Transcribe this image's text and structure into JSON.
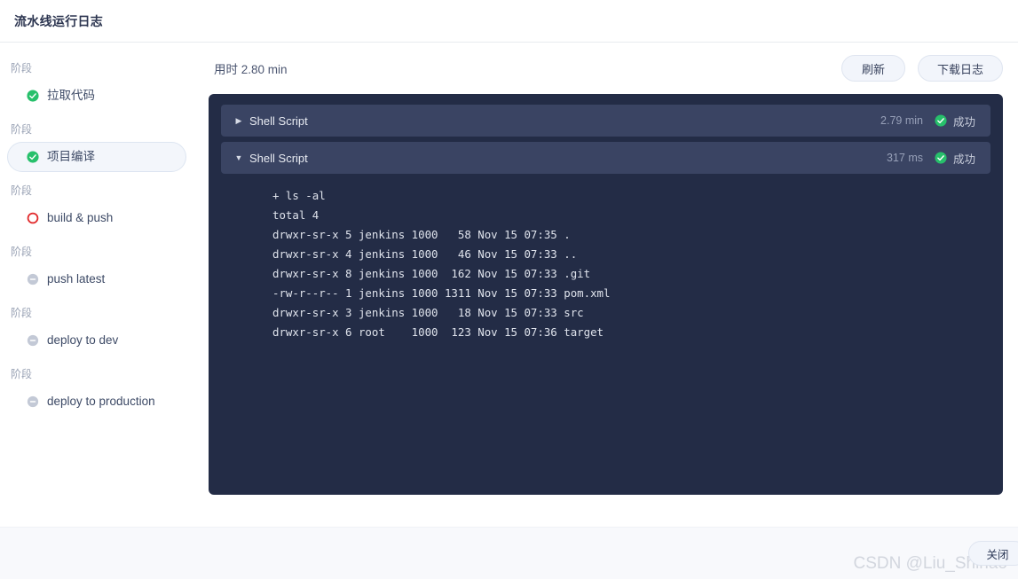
{
  "window": {
    "title": "流水线运行日志"
  },
  "sidebar": {
    "groups": [
      {
        "stage_label": "阶段",
        "name": "拉取代码",
        "status": "success",
        "selected": false
      },
      {
        "stage_label": "阶段",
        "name": "项目编译",
        "status": "success",
        "selected": true
      },
      {
        "stage_label": "阶段",
        "name": "build & push",
        "status": "failed",
        "selected": false
      },
      {
        "stage_label": "阶段",
        "name": "push latest",
        "status": "pending",
        "selected": false
      },
      {
        "stage_label": "阶段",
        "name": "deploy to dev",
        "status": "pending",
        "selected": false
      },
      {
        "stage_label": "阶段",
        "name": "deploy to production",
        "status": "pending",
        "selected": false
      }
    ]
  },
  "toolbar": {
    "duration": "用时 2.80 min",
    "refresh_label": "刷新",
    "download_label": "下载日志"
  },
  "log_panel": {
    "steps": [
      {
        "title": "Shell Script",
        "duration": "2.79 min",
        "status_label": "成功",
        "expanded": false,
        "lines": []
      },
      {
        "title": "Shell Script",
        "duration": "317 ms",
        "status_label": "成功",
        "expanded": true,
        "lines": [
          "+ ls -al",
          "total 4",
          "drwxr-sr-x 5 jenkins 1000   58 Nov 15 07:35 .",
          "drwxr-sr-x 4 jenkins 1000   46 Nov 15 07:33 ..",
          "drwxr-sr-x 8 jenkins 1000  162 Nov 15 07:33 .git",
          "-rw-r--r-- 1 jenkins 1000 1311 Nov 15 07:33 pom.xml",
          "drwxr-sr-x 3 jenkins 1000   18 Nov 15 07:33 src",
          "drwxr-sr-x 6 root    1000  123 Nov 15 07:36 target"
        ]
      }
    ]
  },
  "footer": {
    "close_label": "关闭",
    "watermark": "CSDN @Liu_Shihao"
  },
  "colors": {
    "panel_bg": "#232c46",
    "step_header_bg": "#3a4463",
    "success_green": "#27c06b",
    "failed_red": "#e1292b",
    "pending_gray": "#c3c9d6",
    "accent_pill": "#f2f5fb"
  }
}
